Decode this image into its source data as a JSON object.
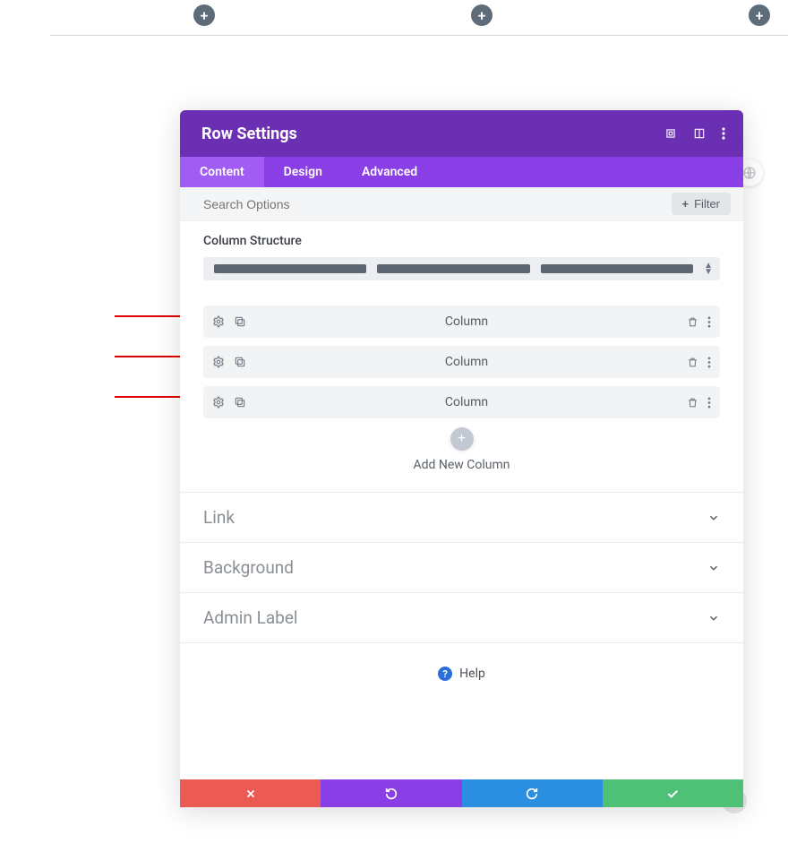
{
  "modal": {
    "title": "Row Settings",
    "tabs": [
      "Content",
      "Design",
      "Advanced"
    ],
    "active_tab": 0,
    "search_placeholder": "Search Options",
    "filter_label": "Filter",
    "section_column_structure": "Column Structure",
    "columns": [
      "Column",
      "Column",
      "Column"
    ],
    "add_new_column_label": "Add New Column",
    "accordions": [
      "Link",
      "Background",
      "Admin Label"
    ],
    "help_label": "Help"
  },
  "colors": {
    "header": "#6b2fb3",
    "tabs_bg": "#8a3ee6",
    "tab_active": "#a15cf4",
    "cancel": "#eb5a53",
    "undo": "#8a3ee6",
    "redo": "#2a8fe0",
    "confirm": "#4fc177"
  }
}
